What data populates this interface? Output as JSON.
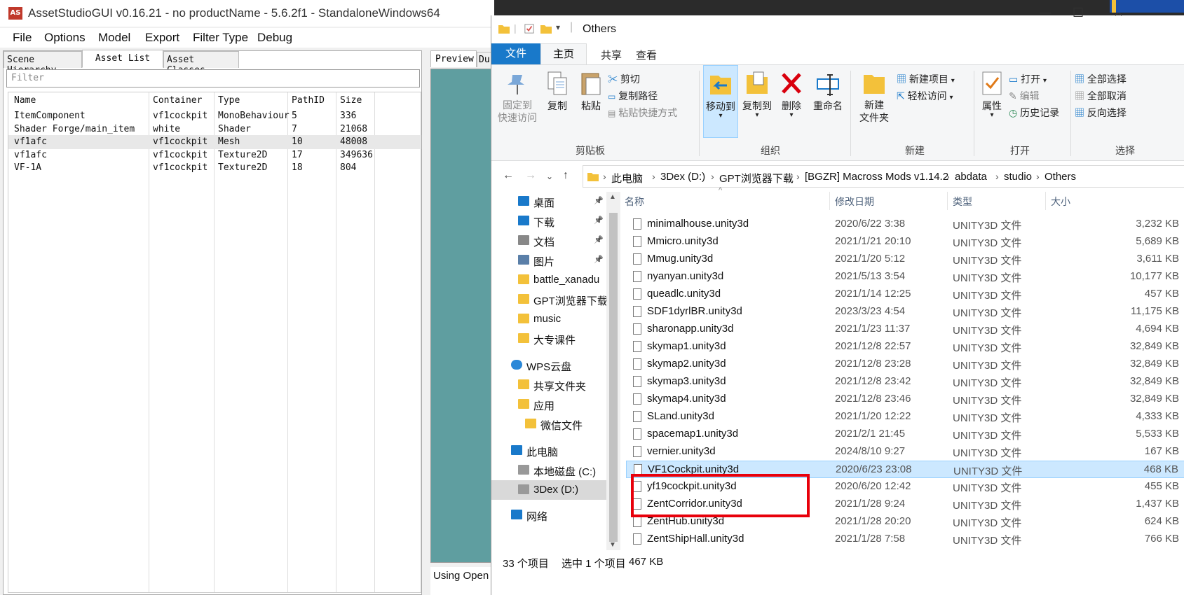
{
  "asset_studio": {
    "title": "AssetStudioGUI v0.16.21 - no productName - 5.6.2f1 - StandaloneWindows64",
    "logo": "AS",
    "menu": [
      "File",
      "Options",
      "Model",
      "Export",
      "Filter Type",
      "Debug"
    ],
    "tabs": [
      "Scene Hierarchy",
      "Asset List",
      "Asset Classes"
    ],
    "filter_placeholder": "Filter",
    "columns": [
      "Name",
      "Container",
      "Type",
      "PathID",
      "Size"
    ],
    "rows": [
      {
        "name": "ItemComponent",
        "container": "vf1cockpit",
        "type": "MonoBehaviour",
        "pathid": "5",
        "size": "336"
      },
      {
        "name": "Shader Forge/main_item",
        "container": "white",
        "type": "Shader",
        "pathid": "7",
        "size": "21068"
      },
      {
        "name": "vf1afc",
        "container": "vf1cockpit",
        "type": "Mesh",
        "pathid": "10",
        "size": "48008"
      },
      {
        "name": "vf1afc",
        "container": "vf1cockpit",
        "type": "Texture2D",
        "pathid": "17",
        "size": "349636"
      },
      {
        "name": "VF-1A",
        "container": "vf1cockpit",
        "type": "Texture2D",
        "pathid": "18",
        "size": "804"
      }
    ],
    "preview_tab": "Preview",
    "preview_tab2": "Du",
    "status": "Using Open"
  },
  "explorer": {
    "title": "Others",
    "ribbon_tabs": {
      "file": "文件",
      "home": "主页",
      "share": "共享",
      "view": "查看"
    },
    "clipboard": {
      "pin": "固定到\n快速访问",
      "copy": "复制",
      "paste": "粘贴",
      "cut": "剪切",
      "copy_path": "复制路径",
      "paste_shortcut": "粘贴快捷方式",
      "group": "剪贴板"
    },
    "organize": {
      "move_to": "移动到",
      "copy_to": "复制到",
      "delete": "删除",
      "rename": "重命名",
      "group": "组织"
    },
    "new": {
      "new_folder": "新建\n文件夹",
      "new_item": "新建项目",
      "easy_access": "轻松访问",
      "group": "新建"
    },
    "open": {
      "properties": "属性",
      "open": "打开",
      "edit": "编辑",
      "history": "历史记录",
      "group": "打开"
    },
    "select": {
      "select_all": "全部选择",
      "select_none": "全部取消",
      "invert": "反向选择",
      "group": "选择"
    },
    "breadcrumb": [
      "此电脑",
      "3Dex (D:)",
      "GPT浏览器下载",
      "[BGZR] Macross Mods v1.14.2",
      "abdata",
      "studio",
      "Others"
    ],
    "nav": [
      {
        "label": "桌面",
        "icon": "desktop-icon",
        "pinned": true
      },
      {
        "label": "下载",
        "icon": "download-icon",
        "pinned": true
      },
      {
        "label": "文档",
        "icon": "document-icon",
        "pinned": true
      },
      {
        "label": "图片",
        "icon": "picture-icon",
        "pinned": true
      },
      {
        "label": "battle_xanadu",
        "icon": "folder-icon",
        "pinned": false
      },
      {
        "label": "GPT浏览器下载",
        "icon": "folder-icon",
        "pinned": false
      },
      {
        "label": "music",
        "icon": "folder-icon",
        "pinned": false
      },
      {
        "label": "大专课件",
        "icon": "folder-icon",
        "pinned": false
      },
      {
        "label": "WPS云盘",
        "icon": "cloud-icon",
        "pinned": false
      },
      {
        "label": "共享文件夹",
        "icon": "shared-folder-icon",
        "pinned": false
      },
      {
        "label": "应用",
        "icon": "folder-icon",
        "pinned": false
      },
      {
        "label": "微信文件",
        "icon": "folder-icon",
        "pinned": false
      },
      {
        "label": "此电脑",
        "icon": "computer-icon",
        "pinned": false
      },
      {
        "label": "本地磁盘 (C:)",
        "icon": "drive-icon",
        "pinned": false
      },
      {
        "label": "3Dex (D:)",
        "icon": "drive-icon",
        "pinned": false
      },
      {
        "label": "网络",
        "icon": "network-icon",
        "pinned": false
      }
    ],
    "columns": {
      "name": "名称",
      "date": "修改日期",
      "type": "类型",
      "size": "大小"
    },
    "files": [
      {
        "name": "minimalhouse.unity3d",
        "date": "2020/6/22 3:38",
        "type": "UNITY3D 文件",
        "size": "3,232 KB"
      },
      {
        "name": "Mmicro.unity3d",
        "date": "2021/1/21 20:10",
        "type": "UNITY3D 文件",
        "size": "5,689 KB"
      },
      {
        "name": "Mmug.unity3d",
        "date": "2021/1/20 5:12",
        "type": "UNITY3D 文件",
        "size": "3,611 KB"
      },
      {
        "name": "nyanyan.unity3d",
        "date": "2021/5/13 3:54",
        "type": "UNITY3D 文件",
        "size": "10,177 KB"
      },
      {
        "name": "queadlc.unity3d",
        "date": "2021/1/14 12:25",
        "type": "UNITY3D 文件",
        "size": "457 KB"
      },
      {
        "name": "SDF1dyrlBR.unity3d",
        "date": "2023/3/23 4:54",
        "type": "UNITY3D 文件",
        "size": "11,175 KB"
      },
      {
        "name": "sharonapp.unity3d",
        "date": "2021/1/23 11:37",
        "type": "UNITY3D 文件",
        "size": "4,694 KB"
      },
      {
        "name": "skymap1.unity3d",
        "date": "2021/12/8 22:57",
        "type": "UNITY3D 文件",
        "size": "32,849 KB"
      },
      {
        "name": "skymap2.unity3d",
        "date": "2021/12/8 23:28",
        "type": "UNITY3D 文件",
        "size": "32,849 KB"
      },
      {
        "name": "skymap3.unity3d",
        "date": "2021/12/8 23:42",
        "type": "UNITY3D 文件",
        "size": "32,849 KB"
      },
      {
        "name": "skymap4.unity3d",
        "date": "2021/12/8 23:46",
        "type": "UNITY3D 文件",
        "size": "32,849 KB"
      },
      {
        "name": "SLand.unity3d",
        "date": "2021/1/20 12:22",
        "type": "UNITY3D 文件",
        "size": "4,333 KB"
      },
      {
        "name": "spacemap1.unity3d",
        "date": "2021/2/1 21:45",
        "type": "UNITY3D 文件",
        "size": "5,533 KB"
      },
      {
        "name": "vernier.unity3d",
        "date": "2024/8/10 9:27",
        "type": "UNITY3D 文件",
        "size": "167 KB"
      },
      {
        "name": "VF1Cockpit.unity3d",
        "date": "2020/6/23 23:08",
        "type": "UNITY3D 文件",
        "size": "468 KB"
      },
      {
        "name": "yf19cockpit.unity3d",
        "date": "2020/6/20 12:42",
        "type": "UNITY3D 文件",
        "size": "455 KB"
      },
      {
        "name": "ZentCorridor.unity3d",
        "date": "2021/1/28 9:24",
        "type": "UNITY3D 文件",
        "size": "1,437 KB"
      },
      {
        "name": "ZentHub.unity3d",
        "date": "2021/1/28 20:20",
        "type": "UNITY3D 文件",
        "size": "624 KB"
      },
      {
        "name": "ZentShipHall.unity3d",
        "date": "2021/1/28 7:58",
        "type": "UNITY3D 文件",
        "size": "766 KB"
      }
    ],
    "status": {
      "count": "33 个项目",
      "selected": "选中 1 个项目",
      "selected_size": "467 KB"
    }
  },
  "colors": {
    "accent": "#1979ca",
    "selection": "#cce8ff",
    "highlight": "#e8000b",
    "preview": "#5f9ea0"
  }
}
